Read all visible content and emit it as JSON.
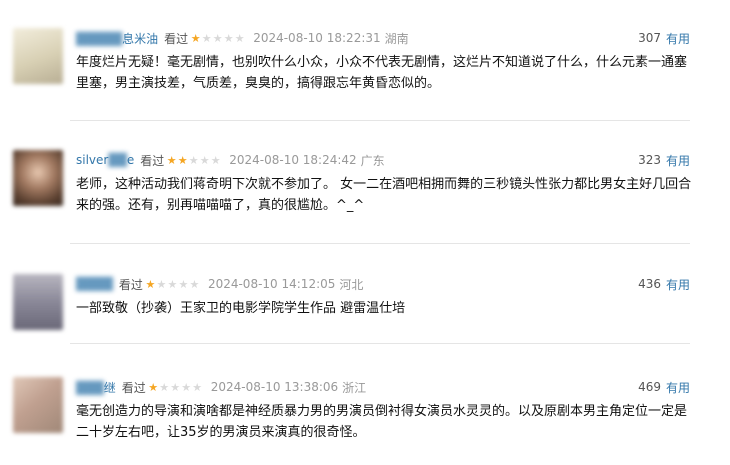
{
  "reviews": [
    {
      "user": "息米油",
      "watched": "看过",
      "rating": 1,
      "time": "2024-08-10 18:22:31",
      "location": "湖南",
      "votes": "307",
      "useful": "有用",
      "content": "年度烂片无疑！毫无剧情，也别吹什么小众，小众不代表无剧情，这烂片不知道说了什么，什么元素一通塞里塞，男主演技差，气质差，臭臭的，搞得跟忘年黄昏恋似的。",
      "avatar_color": "#e6e0c8"
    },
    {
      "user": "silver",
      "watched": "看过",
      "rating": 2,
      "time": "2024-08-10 18:24:42",
      "location": "广东",
      "votes": "323",
      "useful": "有用",
      "content": "老师，这种活动我们蒋奇明下次就不参加了。 女一二在酒吧相拥而舞的三秒镜头性张力都比男女主好几回合来的强。还有，别再喵喵喵了，真的很尴尬。^_^",
      "avatar_color": "#b89a80"
    },
    {
      "user": "笑小路遥",
      "watched": "看过",
      "rating": 1,
      "time": "2024-08-10 14:12:05",
      "location": "河北",
      "votes": "436",
      "useful": "有用",
      "content": "一部致敬（抄袭）王家卫的电影学院学生作品 避雷温仕培",
      "avatar_color": "#9a98a8"
    },
    {
      "user": "继",
      "watched": "看过",
      "rating": 1,
      "time": "2024-08-10 13:38:06",
      "location": "浙江",
      "votes": "469",
      "useful": "有用",
      "content": "毫无创造力的导演和演啥都是神经质暴力男的男演员倒衬得女演员水灵灵的。以及原剧本男主角定位一定是二十岁左右吧，让35岁的男演员来演真的很奇怪。",
      "avatar_color": "#c8b0a0"
    }
  ]
}
